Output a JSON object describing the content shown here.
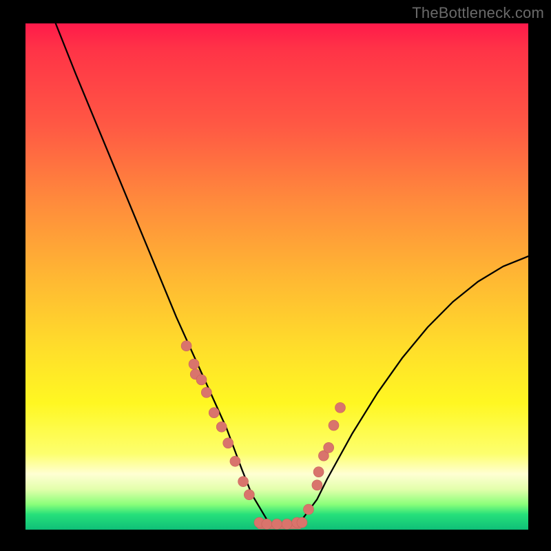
{
  "watermark": {
    "text": "TheBottleneck.com"
  },
  "chart_data": {
    "type": "line",
    "title": "",
    "xlabel": "",
    "ylabel": "",
    "xlim": [
      0,
      100
    ],
    "ylim": [
      0,
      100
    ],
    "grid": false,
    "legend": false,
    "series": [
      {
        "name": "curve",
        "x": [
          6,
          10,
          15,
          20,
          25,
          30,
          35,
          40,
          43,
          45,
          48,
          50,
          52,
          55,
          58,
          60,
          65,
          70,
          75,
          80,
          85,
          90,
          95,
          100
        ],
        "y": [
          100,
          90,
          78,
          66,
          54,
          42,
          31,
          20,
          12,
          7,
          2,
          0.5,
          0.5,
          2,
          6,
          10,
          19,
          27,
          34,
          40,
          45,
          49,
          52,
          54
        ]
      }
    ],
    "markers": {
      "name": "dots",
      "x": [
        32.0,
        33.5,
        33.8,
        35.0,
        36.0,
        37.5,
        39.0,
        40.3,
        41.7,
        43.3,
        44.5,
        46.5,
        48.0,
        50.0,
        52.0,
        54.0,
        55.0,
        56.3,
        58.0,
        58.3,
        59.3,
        60.3,
        61.3,
        62.6
      ],
      "y": [
        36.3,
        32.7,
        30.7,
        29.6,
        27.1,
        23.1,
        20.3,
        17.1,
        13.5,
        9.5,
        6.9,
        1.4,
        1.1,
        1.1,
        1.1,
        1.4,
        1.4,
        4.0,
        8.8,
        11.4,
        14.6,
        16.2,
        20.6,
        24.1
      ]
    },
    "flat_bottom": {
      "x_start": 46,
      "x_end": 55,
      "y": 0.7
    },
    "colors": {
      "curve_stroke": "#000000",
      "marker_fill": "#d9746c",
      "marker_stroke": "#c7625b",
      "gradient_top": "#ff1a4a",
      "gradient_bottom": "#0fbf78"
    }
  }
}
